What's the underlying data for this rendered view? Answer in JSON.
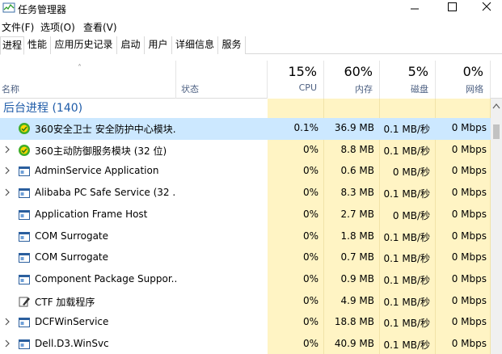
{
  "window": {
    "title": "任务管理器"
  },
  "menu": [
    "文件(F)",
    "选项(O)",
    "查看(V)"
  ],
  "tabs": [
    "进程",
    "性能",
    "应用历史记录",
    "启动",
    "用户",
    "详细信息",
    "服务"
  ],
  "header": {
    "name": "名称",
    "status": "状态",
    "cpu": {
      "pct": "15%",
      "label": "CPU"
    },
    "mem": {
      "pct": "60%",
      "label": "内存"
    },
    "disk": {
      "pct": "5%",
      "label": "磁盘"
    },
    "net": {
      "pct": "0%",
      "label": "网络"
    }
  },
  "group": {
    "label": "后台进程 (140)"
  },
  "processes": [
    {
      "name": "360安全卫士 安全防护中心模块...",
      "icon": "360-shield-icon",
      "expandable": false,
      "selected": true,
      "cpu": "0.1%",
      "mem": "36.9 MB",
      "disk": "0.1 MB/秒",
      "net": "0 Mbps"
    },
    {
      "name": "360主动防御服务模块 (32 位)",
      "icon": "360-shield-icon",
      "expandable": true,
      "selected": false,
      "cpu": "0%",
      "mem": "8.8 MB",
      "disk": "0.1 MB/秒",
      "net": "0 Mbps"
    },
    {
      "name": "AdminService Application",
      "icon": "app-window-icon",
      "expandable": true,
      "selected": false,
      "cpu": "0%",
      "mem": "0.6 MB",
      "disk": "0 MB/秒",
      "net": "0 Mbps"
    },
    {
      "name": "Alibaba PC Safe Service (32 ...",
      "icon": "app-window-icon",
      "expandable": true,
      "selected": false,
      "cpu": "0%",
      "mem": "8.3 MB",
      "disk": "0.1 MB/秒",
      "net": "0 Mbps"
    },
    {
      "name": "Application Frame Host",
      "icon": "app-window-icon",
      "expandable": false,
      "selected": false,
      "cpu": "0%",
      "mem": "2.7 MB",
      "disk": "0 MB/秒",
      "net": "0 Mbps"
    },
    {
      "name": "COM Surrogate",
      "icon": "app-window-icon",
      "expandable": false,
      "selected": false,
      "cpu": "0%",
      "mem": "1.8 MB",
      "disk": "0.1 MB/秒",
      "net": "0 Mbps"
    },
    {
      "name": "COM Surrogate",
      "icon": "app-window-icon",
      "expandable": false,
      "selected": false,
      "cpu": "0%",
      "mem": "0.7 MB",
      "disk": "0.1 MB/秒",
      "net": "0 Mbps"
    },
    {
      "name": "Component Package Suppor...",
      "icon": "app-window-icon",
      "expandable": false,
      "selected": false,
      "cpu": "0%",
      "mem": "0.9 MB",
      "disk": "0.1 MB/秒",
      "net": "0 Mbps"
    },
    {
      "name": "CTF 加载程序",
      "icon": "ctf-pen-icon",
      "expandable": false,
      "selected": false,
      "cpu": "0%",
      "mem": "4.9 MB",
      "disk": "0.1 MB/秒",
      "net": "0 Mbps"
    },
    {
      "name": "DCFWinService",
      "icon": "app-window-icon",
      "expandable": true,
      "selected": false,
      "cpu": "0%",
      "mem": "18.8 MB",
      "disk": "0.1 MB/秒",
      "net": "0 Mbps"
    },
    {
      "name": "Dell.D3.WinSvc",
      "icon": "app-window-icon",
      "expandable": true,
      "selected": false,
      "cpu": "0%",
      "mem": "40.9 MB",
      "disk": "0.1 MB/秒",
      "net": "0 Mbps"
    }
  ],
  "colors": {
    "group_text": "#1e5ba8",
    "selected_row": "#cce8ff",
    "heat_cell": "#fff4c4",
    "header_label": "#4d6082"
  }
}
